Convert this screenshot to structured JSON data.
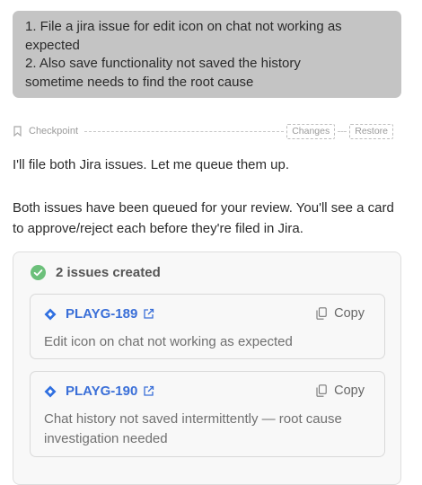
{
  "user_message": {
    "line1": "1. File a jira issue for edit icon on chat not working as",
    "line2": "expected",
    "line3": "2. Also save functionality not saved the history",
    "line4": "sometime needs to find the root cause"
  },
  "checkpoint": {
    "label": "Checkpoint",
    "changes_label": "Changes",
    "restore_label": "Restore",
    "icon": "bookmark-icon"
  },
  "assistant": {
    "message1": "I'll file both Jira issues. Let me queue them up.",
    "message2": "Both issues have been queued for your review. You'll see a card to approve/reject each before they're filed in Jira."
  },
  "result_card": {
    "title": "2 issues created",
    "status_color": "#6cc07a",
    "issues": [
      {
        "key": "PLAYG-189",
        "summary": "Edit icon on chat not working as expected",
        "copy_label": "Copy"
      },
      {
        "key": "PLAYG-190",
        "summary": "Chat history not saved intermittently — root cause investigation needed",
        "copy_label": "Copy"
      }
    ]
  },
  "colors": {
    "accent": "#3a6fd8",
    "user_bubble": "#c4c4c4",
    "success": "#6cc07a"
  }
}
